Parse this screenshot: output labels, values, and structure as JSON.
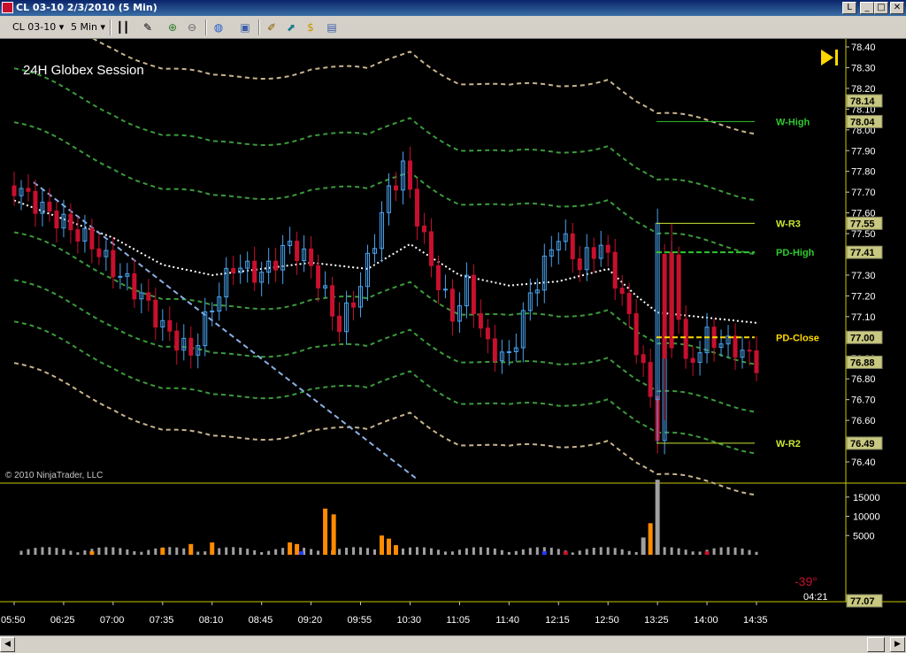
{
  "window": {
    "title": "CL 03-10  2/3/2010 (5 Min)",
    "buttons": [
      "_",
      "□",
      "✕"
    ]
  },
  "toolbar": {
    "instrument": "CL 03-10",
    "interval": "5 Min",
    "icons": [
      "bar-type-icon",
      "pencil-draw-icon",
      "zoom-in-icon",
      "zoom-out-icon",
      "globe-icon",
      "properties-icon",
      "indicators-icon",
      "strategies-icon",
      "coin-icon",
      "data-box-icon"
    ]
  },
  "chart": {
    "session_label": "24H Globex Session",
    "copyright": "© 2010 NinjaTrader, LLC",
    "colors": {
      "background": "#000000",
      "up": "#4aa3f0",
      "down": "#c8102e",
      "frame": "#c8c800",
      "band_outer": "#c8b48c",
      "band_green": "#3c9a3c",
      "vwap": "#ffffff",
      "trendline": "#8cb0e6"
    }
  },
  "price_axis": {
    "ticks": [
      "78.40",
      "78.30",
      "78.20",
      "78.10",
      "78.00",
      "77.90",
      "77.80",
      "77.70",
      "77.60",
      "77.50",
      "77.40",
      "77.30",
      "77.20",
      "77.10",
      "77.00",
      "76.90",
      "76.80",
      "76.70",
      "76.60",
      "76.50",
      "76.40"
    ],
    "tags": [
      {
        "label": "78.14",
        "price": 78.14
      },
      {
        "label": "78.04",
        "price": 78.04
      },
      {
        "label": "77.55",
        "price": 77.55
      },
      {
        "label": "77.41",
        "price": 77.41
      },
      {
        "label": "77.00",
        "price": 77.0
      },
      {
        "label": "76.88",
        "price": 76.88
      },
      {
        "label": "76.49",
        "price": 76.49
      }
    ]
  },
  "levels": [
    {
      "name": "W-High",
      "price": 78.04,
      "color": "#2ec82e",
      "dashed": false
    },
    {
      "name": "W-R3",
      "price": 77.55,
      "color": "#c8e632",
      "dashed": false
    },
    {
      "name": "PD-High",
      "price": 77.41,
      "color": "#2ec82e",
      "dashed": true
    },
    {
      "name": "PD-Close",
      "price": 77.0,
      "color": "#ffd700",
      "dashed": true
    },
    {
      "name": "W-R2",
      "price": 76.49,
      "color": "#c8e632",
      "dashed": false
    }
  ],
  "volume_axis": {
    "ticks": [
      "15000",
      "10000",
      "5000"
    ],
    "tag": "77.07"
  },
  "status": {
    "angle": "-39°",
    "countdown": "04:21"
  },
  "time_axis": {
    "labels": [
      "05:50",
      "06:25",
      "07:00",
      "07:35",
      "08:10",
      "08:45",
      "09:20",
      "09:55",
      "10:30",
      "11:05",
      "11:40",
      "12:15",
      "12:50",
      "13:25",
      "14:00",
      "14:35"
    ]
  },
  "chart_data": {
    "type": "candlestick",
    "x_labels": [
      "05:50",
      "06:25",
      "07:00",
      "07:35",
      "08:10",
      "08:45",
      "09:20",
      "09:55",
      "10:30",
      "11:05",
      "11:40",
      "12:15",
      "12:50",
      "13:25",
      "14:00",
      "14:35"
    ],
    "ylim": [
      76.35,
      78.42
    ],
    "y_ticks": [
      78.4,
      78.3,
      78.2,
      78.1,
      78.0,
      77.9,
      77.8,
      77.7,
      77.6,
      77.5,
      77.4,
      77.3,
      77.2,
      77.1,
      77.0,
      76.9,
      76.8,
      76.7,
      76.6,
      76.5,
      76.4
    ],
    "close_points": [
      {
        "time": "05:50",
        "price": 77.73
      },
      {
        "time": "06:10",
        "price": 77.62
      },
      {
        "time": "06:25",
        "price": 77.55
      },
      {
        "time": "06:45",
        "price": 77.45
      },
      {
        "time": "07:00",
        "price": 77.33
      },
      {
        "time": "07:20",
        "price": 77.2
      },
      {
        "time": "07:35",
        "price": 77.05
      },
      {
        "time": "07:55",
        "price": 76.92
      },
      {
        "time": "08:10",
        "price": 77.15
      },
      {
        "time": "08:25",
        "price": 77.35
      },
      {
        "time": "08:45",
        "price": 77.3
      },
      {
        "time": "09:05",
        "price": 77.45
      },
      {
        "time": "09:20",
        "price": 77.35
      },
      {
        "time": "09:40",
        "price": 77.05
      },
      {
        "time": "09:55",
        "price": 77.25
      },
      {
        "time": "10:15",
        "price": 77.7
      },
      {
        "time": "10:25",
        "price": 77.82
      },
      {
        "time": "10:30",
        "price": 77.7
      },
      {
        "time": "10:45",
        "price": 77.35
      },
      {
        "time": "11:00",
        "price": 77.1
      },
      {
        "time": "11:10",
        "price": 77.25
      },
      {
        "time": "11:25",
        "price": 76.95
      },
      {
        "time": "11:40",
        "price": 76.9
      },
      {
        "time": "11:55",
        "price": 77.2
      },
      {
        "time": "12:15",
        "price": 77.5
      },
      {
        "time": "12:30",
        "price": 77.35
      },
      {
        "time": "12:45",
        "price": 77.45
      },
      {
        "time": "13:00",
        "price": 77.2
      },
      {
        "time": "13:15",
        "price": 76.85
      },
      {
        "time": "13:25",
        "price": 76.55
      },
      {
        "time": "13:35",
        "price": 77.4
      },
      {
        "time": "13:45",
        "price": 76.85
      },
      {
        "time": "14:00",
        "price": 77.0
      },
      {
        "time": "14:20",
        "price": 76.95
      },
      {
        "time": "14:35",
        "price": 76.88
      }
    ],
    "vwap_ref": [
      {
        "time": "05:50",
        "price": 77.66
      },
      {
        "time": "07:00",
        "price": 77.48
      },
      {
        "time": "07:35",
        "price": 77.35
      },
      {
        "time": "08:10",
        "price": 77.3
      },
      {
        "time": "09:20",
        "price": 77.36
      },
      {
        "time": "10:00",
        "price": 77.33
      },
      {
        "time": "10:30",
        "price": 77.45
      },
      {
        "time": "11:05",
        "price": 77.3
      },
      {
        "time": "11:40",
        "price": 77.25
      },
      {
        "time": "12:15",
        "price": 77.27
      },
      {
        "time": "12:50",
        "price": 77.33
      },
      {
        "time": "13:10",
        "price": 77.2
      },
      {
        "time": "13:25",
        "price": 77.12
      },
      {
        "time": "14:35",
        "price": 77.07
      }
    ],
    "band_offsets": [
      0.94,
      0.62,
      0.36,
      -0.17,
      -0.4,
      -0.6,
      -0.8
    ],
    "volume": {
      "ylim": [
        0,
        20000
      ],
      "bars": [
        {
          "time": "06:45",
          "value": 900,
          "color": "#ff8c00"
        },
        {
          "time": "07:35",
          "value": 1800,
          "color": "#ff8c00"
        },
        {
          "time": "07:55",
          "value": 2800,
          "color": "#ff8c00"
        },
        {
          "time": "08:10",
          "value": 3200,
          "color": "#ff8c00"
        },
        {
          "time": "09:05",
          "value": 3200,
          "color": "#ff8c00"
        },
        {
          "time": "09:10",
          "value": 2800,
          "color": "#ff8c00"
        },
        {
          "time": "09:13",
          "value": 900,
          "color": "#1e3cff"
        },
        {
          "time": "09:30",
          "value": 12000,
          "color": "#ff8c00"
        },
        {
          "time": "09:36",
          "value": 10500,
          "color": "#ff8c00"
        },
        {
          "time": "10:10",
          "value": 5000,
          "color": "#ff8c00"
        },
        {
          "time": "10:15",
          "value": 4200,
          "color": "#ff8c00"
        },
        {
          "time": "10:20",
          "value": 2500,
          "color": "#ff8c00"
        },
        {
          "time": "12:05",
          "value": 900,
          "color": "#1e3cff"
        },
        {
          "time": "12:20",
          "value": 900,
          "color": "#c8102e"
        },
        {
          "time": "13:25",
          "value": 19500,
          "color": "#a0a0a0"
        },
        {
          "time": "13:20",
          "value": 8200,
          "color": "#ff8c00"
        },
        {
          "time": "13:15",
          "value": 4500,
          "color": "#a0a0a0"
        },
        {
          "time": "14:00",
          "value": 900,
          "color": "#c8102e"
        }
      ]
    }
  }
}
